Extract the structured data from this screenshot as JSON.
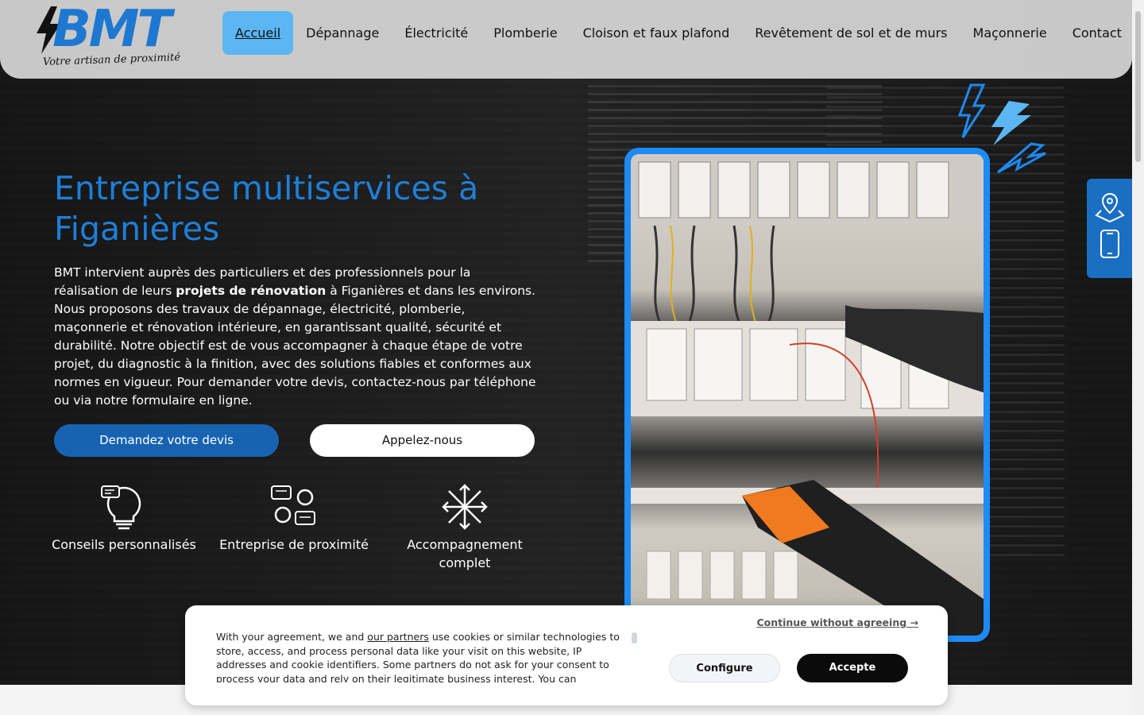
{
  "brand": {
    "name": "BMT",
    "tagline": "Votre artisan de proximité",
    "accent": "#1e7fd8"
  },
  "nav": {
    "items": [
      {
        "label": "Accueil",
        "active": true
      },
      {
        "label": "Dépannage"
      },
      {
        "label": "Électricité"
      },
      {
        "label": "Plomberie"
      },
      {
        "label": "Cloison et faux plafond"
      },
      {
        "label": "Revêtement de sol et de murs"
      },
      {
        "label": "Maçonnerie"
      },
      {
        "label": "Contact"
      }
    ]
  },
  "hero": {
    "title": "Entreprise multiservices à Figanières",
    "desc_part1": "BMT intervient auprès des particuliers et des professionnels pour la réalisation de leurs ",
    "desc_bold": "projets de rénovation",
    "desc_part2": " à Figanières et dans les environs. Nous proposons des travaux de dépannage, électricité, plomberie, maçonnerie et rénovation intérieure, en garantissant qualité, sécurité et durabilité. Notre objectif est de vous accompagner à chaque étape de votre projet, du diagnostic à la finition, avec des solutions fiables et conformes aux normes en vigueur. Pour demander votre devis, contactez-nous par téléphone ou via notre formulaire en ligne.",
    "btn_devis": "Demandez votre devis",
    "btn_call": "Appelez-nous",
    "features": [
      {
        "label": "Conseils personnalisés",
        "icon": "lightbulb-chat-icon"
      },
      {
        "label": "Entreprise de proximité",
        "icon": "people-chat-icon"
      },
      {
        "label": "Accompagnement complet",
        "icon": "arrows-expand-icon"
      }
    ]
  },
  "floating": {
    "icons": [
      "map-pin-icon",
      "phone-icon"
    ]
  },
  "cookie": {
    "text_before": "With your agreement, we and ",
    "link": "our partners",
    "text_after": " use cookies or similar technologies to store, access, and process personal data like your visit on this website, IP addresses and cookie identifiers. Some partners do not ask for your consent to process your data and rely on their legitimate business interest. You can",
    "continue": "Continue without agreeing →",
    "configure": "Configure",
    "accept": "Accepte"
  }
}
